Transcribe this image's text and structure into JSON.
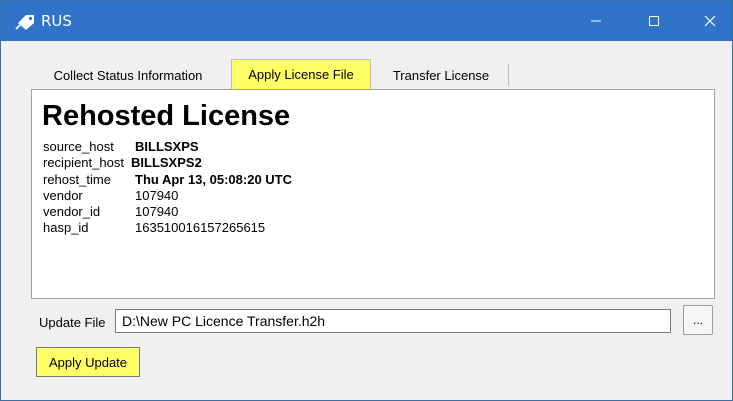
{
  "window": {
    "title": "RUS",
    "minimize_glyph": "—",
    "maximize_glyph": "☐",
    "close_glyph": "✕",
    "icon": "key-tag-icon",
    "titlebar_color": "#2f74c8",
    "highlight_color": "#ffff66"
  },
  "tabs": [
    {
      "label": "Collect Status Information",
      "selected": false
    },
    {
      "label": "Apply License File",
      "selected": true
    },
    {
      "label": "Transfer License",
      "selected": false
    }
  ],
  "license": {
    "heading": "Rehosted License",
    "fields": [
      {
        "key": "source_host",
        "value": "BILLSXPS"
      },
      {
        "key": "recipient_host",
        "value": "BILLSXPS2"
      },
      {
        "key": "rehost_time",
        "value": "Thu Apr 13, 05:08:20 UTC"
      },
      {
        "key": "vendor",
        "value": "107940"
      },
      {
        "key": "vendor_id",
        "value": "107940"
      },
      {
        "key": "hasp_id",
        "value": "163510016157265615"
      }
    ]
  },
  "update": {
    "label": "Update File",
    "value": "D:\\New PC Licence Transfer.h2h",
    "browse_label": "...",
    "apply_label": "Apply Update"
  }
}
